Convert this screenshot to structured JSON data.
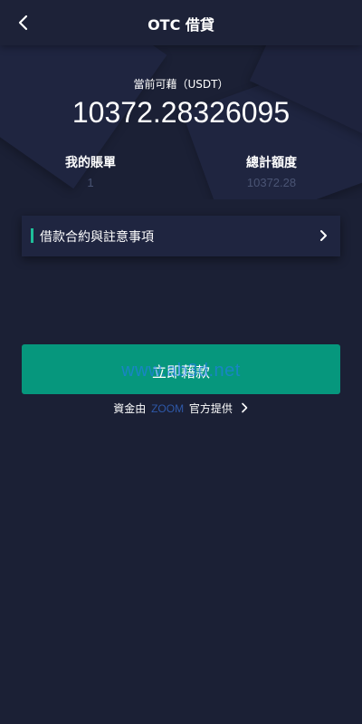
{
  "nav": {
    "title": "OTC 借貸",
    "back_icon": "chevron-left-icon"
  },
  "balance": {
    "label": "當前可藉（USDT）",
    "value": "10372.28326095"
  },
  "stats": {
    "bills": {
      "label": "我的賬單",
      "value": "1"
    },
    "quota": {
      "label": "總計額度",
      "value": "10372.28"
    }
  },
  "agreement": {
    "label": "借款合約與註意事項",
    "icon": "chevron-right-icon"
  },
  "borrow_button": {
    "label": "立即藉款"
  },
  "watermark": "www.ab3d.net",
  "provider": {
    "prefix": "資金由",
    "brand": "ZOOM",
    "suffix": "官方提供"
  },
  "colors": {
    "background": "#1b2035",
    "accent": "#06977d",
    "brand": "#2e58a8",
    "muted": "#4a5474"
  }
}
